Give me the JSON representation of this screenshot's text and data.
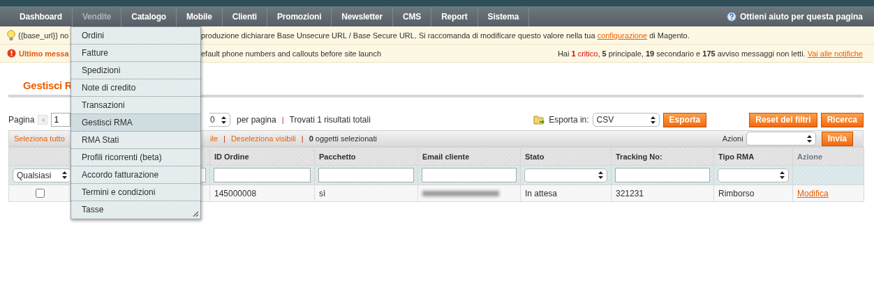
{
  "nav": {
    "items": [
      {
        "label": "Dashboard",
        "selected": false
      },
      {
        "label": "Vendite",
        "selected": true
      },
      {
        "label": "Catalogo",
        "selected": false
      },
      {
        "label": "Mobile",
        "selected": false
      },
      {
        "label": "Clienti",
        "selected": false
      },
      {
        "label": "Promozioni",
        "selected": false
      },
      {
        "label": "Newsletter",
        "selected": false
      },
      {
        "label": "CMS",
        "selected": false
      },
      {
        "label": "Report",
        "selected": false
      },
      {
        "label": "Sistema",
        "selected": false
      }
    ],
    "help": "Ottieni aiuto per questa pagina"
  },
  "menu": {
    "items": [
      {
        "label": "Ordini",
        "selected": false
      },
      {
        "label": "Fatture",
        "selected": false
      },
      {
        "label": "Spedizioni",
        "selected": false
      },
      {
        "label": "Note di credito",
        "selected": false
      },
      {
        "label": "Transazioni",
        "selected": false
      },
      {
        "label": "Gestisci RMA",
        "selected": true
      },
      {
        "label": "RMA Stati",
        "selected": false
      },
      {
        "label": "Profili ricorrenti (beta)",
        "selected": false
      },
      {
        "label": "Accordo fatturazione",
        "selected": false
      },
      {
        "label": "Termini e condizioni",
        "selected": false
      },
      {
        "label": "Tasse",
        "selected": false
      }
    ]
  },
  "notices": [
    {
      "kind": "info",
      "fragment": "{{base_url}} no",
      "text": "produzione dichiarare Base Unsecure URL / Base Secure URL. Si raccomanda di modificare questo valore nella tua",
      "link": "configurazione",
      "after": "di Magento."
    },
    {
      "kind": "error",
      "fragment": "Ultimo messa",
      "text": "efault phone numbers and callouts before site launch",
      "summary": {
        "prefix": "Hai",
        "critical_count": "1",
        "critical_label": "critico",
        "rest": ", **5** principale, **19** secondario e **175** avviso messaggi non letti.",
        "link": "Vai alle notifiche"
      }
    }
  ],
  "page_title": "Gestisci R",
  "pager": {
    "label": "Pagina",
    "page": "1",
    "per_page": "0",
    "per_page_label": "per pagina",
    "separator": "|",
    "found": "Trovati 1 risultati totali"
  },
  "export": {
    "label": "Esporta in:",
    "format": "CSV",
    "button": "Esporta"
  },
  "buttons": [
    "Reset del filtri",
    "Ricerca"
  ],
  "massaction": {
    "links": [
      "Seleziona tutto",
      "ile",
      "Deseleziona visibili"
    ],
    "separator": "|",
    "count": "**0** oggetti selezionati",
    "actions_label": "Azioni",
    "submit": "Invia"
  },
  "table": {
    "columns": [
      {
        "kind": "select",
        "filter_value": "Qualsiasi"
      },
      {
        "kind": "text"
      },
      {
        "header": "ID Ordine",
        "kind": "text"
      },
      {
        "header": "Pacchetto",
        "kind": "text"
      },
      {
        "header": "Email cliente",
        "kind": "text"
      },
      {
        "header": "Stato",
        "kind": "select"
      },
      {
        "header": "Tracking No:",
        "kind": "text"
      },
      {
        "header": "Tipo RMA",
        "kind": "select"
      },
      {
        "header": "Azione",
        "kind": "none"
      }
    ],
    "rows": [
      {
        "cells": [
          {
            "kind": "checkbox",
            "checked": false
          },
          {
            "kind": "empty"
          },
          {
            "kind": "text",
            "text": "145000008"
          },
          {
            "kind": "text",
            "text": "sì"
          },
          {
            "kind": "blurred"
          },
          {
            "kind": "text",
            "text": "In attesa"
          },
          {
            "kind": "text",
            "text": "321231"
          },
          {
            "kind": "text",
            "text": "Rimborso"
          },
          {
            "kind": "link",
            "text": "Modifica"
          }
        ]
      }
    ]
  }
}
